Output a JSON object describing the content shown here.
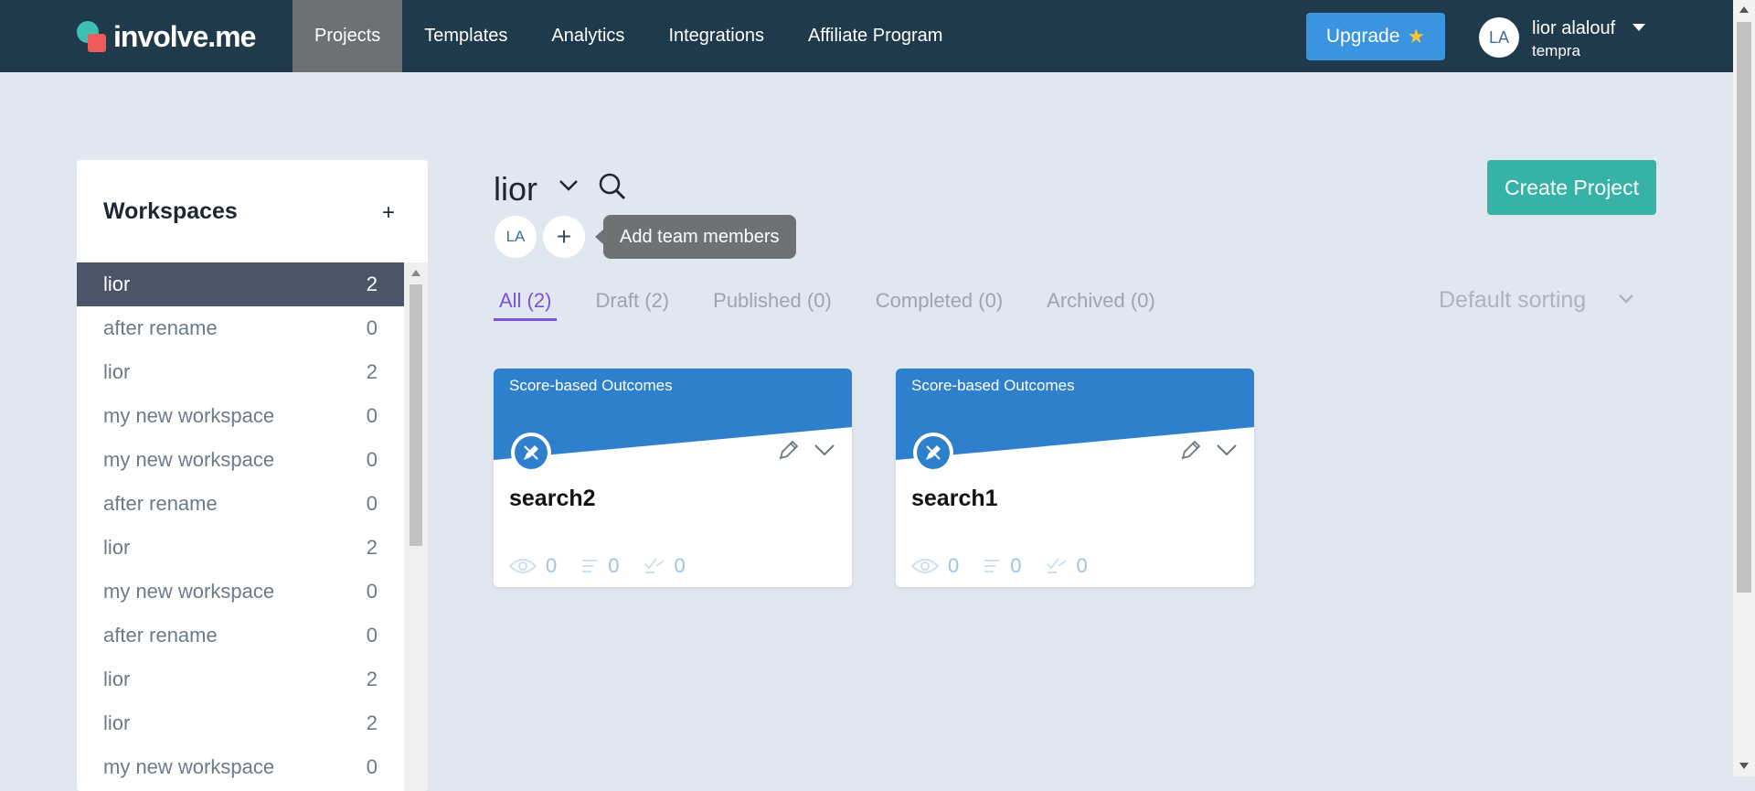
{
  "brand": {
    "name": "involve.me"
  },
  "nav": {
    "items": [
      {
        "label": "Projects",
        "active": true
      },
      {
        "label": "Templates"
      },
      {
        "label": "Analytics"
      },
      {
        "label": "Integrations"
      },
      {
        "label": "Affiliate Program"
      }
    ]
  },
  "upgrade": {
    "label": "Upgrade",
    "icon": "star-icon"
  },
  "user": {
    "initials": "LA",
    "name": "lior alalouf",
    "org": "tempra"
  },
  "sidebar": {
    "title": "Workspaces",
    "add_icon": "+",
    "items": [
      {
        "name": "lior",
        "count": "2",
        "active": true
      },
      {
        "name": "after rename",
        "count": "0"
      },
      {
        "name": "lior",
        "count": "2"
      },
      {
        "name": "my new workspace",
        "count": "0"
      },
      {
        "name": "my new workspace",
        "count": "0"
      },
      {
        "name": "after rename",
        "count": "0"
      },
      {
        "name": "lior",
        "count": "2"
      },
      {
        "name": "my new workspace",
        "count": "0"
      },
      {
        "name": "after rename",
        "count": "0"
      },
      {
        "name": "lior",
        "count": "2"
      },
      {
        "name": "lior",
        "count": "2"
      },
      {
        "name": "my new workspace",
        "count": "0"
      }
    ]
  },
  "workspace": {
    "title": "lior",
    "member_initials": "LA",
    "add_member_icon": "+",
    "tooltip": "Add team members"
  },
  "create_button": "Create Project",
  "filters": [
    {
      "label": "All (2)",
      "active": true
    },
    {
      "label": "Draft (2)"
    },
    {
      "label": "Published (0)"
    },
    {
      "label": "Completed (0)"
    },
    {
      "label": "Archived (0)"
    }
  ],
  "sorting": {
    "label": "Default sorting"
  },
  "projects": [
    {
      "type": "Score-based Outcomes",
      "title": "search2",
      "views": "0",
      "submissions": "0",
      "completions": "0"
    },
    {
      "type": "Score-based Outcomes",
      "title": "search1",
      "views": "0",
      "submissions": "0",
      "completions": "0"
    }
  ],
  "colors": {
    "topbar": "#1e3a4b",
    "accent_teal": "#36b2a6",
    "upgrade_blue": "#3a94e0",
    "card_blue": "#2f80cc",
    "active_filter": "#7a53d6"
  }
}
